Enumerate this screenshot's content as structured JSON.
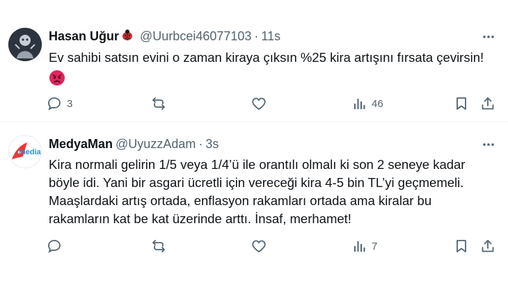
{
  "colors": {
    "text": "#0f1419",
    "secondary": "#536471",
    "divider": "#eff3f4",
    "angry_emoji": "#e0245e",
    "badge_red": "#d92d2d"
  },
  "tweets": [
    {
      "name": "Hasan Uğur",
      "badge_icon": "ladybug-icon",
      "handle": "@Uurbcei46077103",
      "dot": "·",
      "time": "11s",
      "text": "Ev sahibi satsın evini o zaman kiraya çıksın %25 kira artışını fırsata çevirsin!",
      "emoji": "angry-face-emoji",
      "replies": "3",
      "retweets": "",
      "likes": "",
      "views": "46"
    },
    {
      "name": "MedyaMan",
      "handle": "@UyuzzAdam",
      "dot": "·",
      "time": "3s",
      "avatar_text": "media",
      "text_lines": [
        "Kira normali gelirin 1/5 veya 1/4’ü ile orantılı olmalı ki son 2 seneye kadar",
        "böyle idi. Yani bir asgari ücretli için vereceği kira 4-5 bin TL’yi geçmemeli.",
        "Maaşlardaki artış ortada, enflasyon rakamları ortada ama kiralar bu",
        "rakamların kat be kat üzerinde arttı. İnsaf, merhamet!"
      ],
      "replies": "",
      "retweets": "",
      "likes": "",
      "views": "7"
    }
  ]
}
